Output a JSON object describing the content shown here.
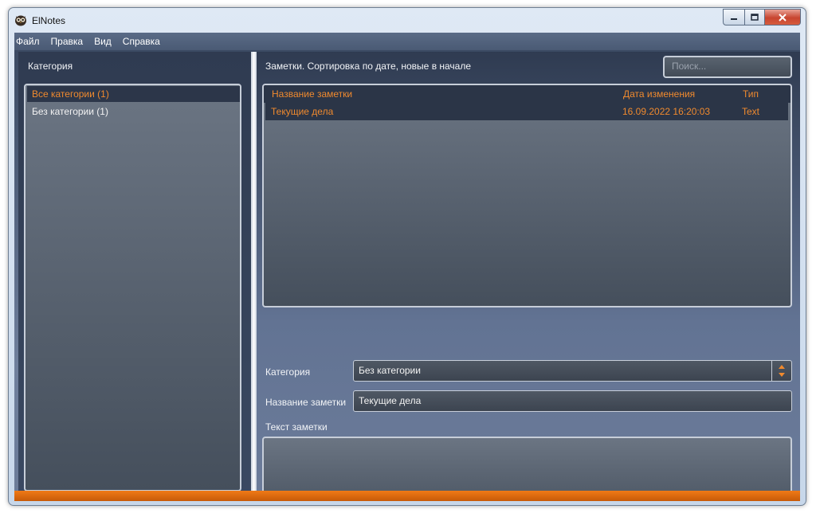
{
  "window": {
    "title": "ElNotes"
  },
  "menu": {
    "items": [
      "Файл",
      "Правка",
      "Вид",
      "Справка"
    ]
  },
  "categories": {
    "label": "Категория",
    "items": [
      {
        "label": "Все категории (1)"
      },
      {
        "label": "Без категории (1)"
      }
    ]
  },
  "notes": {
    "header": "Заметки. Сортировка по дате, новые в начале",
    "search_placeholder": "Поиск...",
    "columns": [
      "Название заметки",
      "Дата изменения",
      "Тип"
    ],
    "rows": [
      {
        "name": "Текущие дела",
        "date": "16.09.2022 16:20:03",
        "type": "Text"
      }
    ]
  },
  "editor": {
    "category_label": "Категория",
    "category_value": "Без категории",
    "name_label": "Название заметки",
    "name_value": "Текущие дела",
    "text_label": "Текст заметки",
    "text_value": ""
  },
  "colors": {
    "accent": "#f08a2e",
    "status_bar": "#e56f0e"
  }
}
